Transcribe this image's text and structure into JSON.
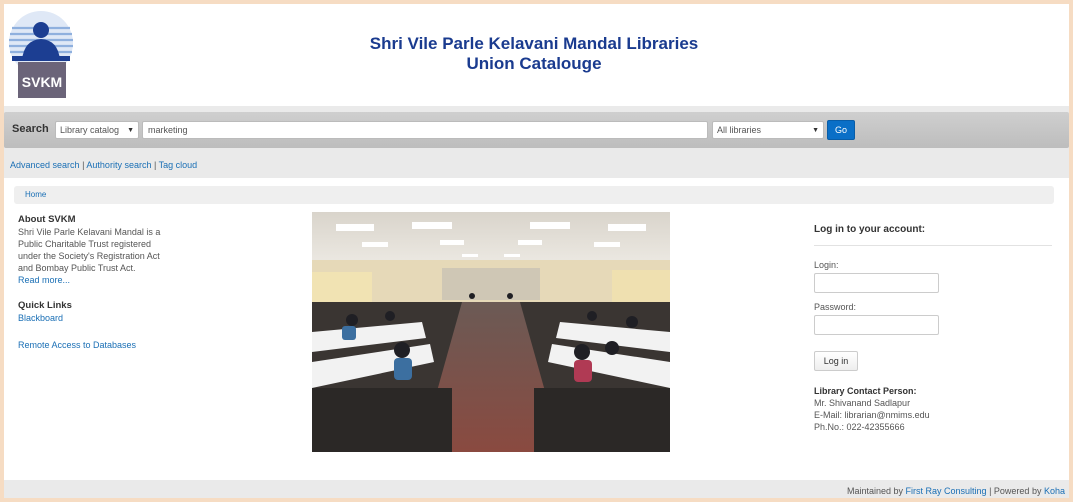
{
  "header": {
    "logo_text": "SVKM",
    "title_line1": "Shri Vile Parle Kelavani Mandal Libraries",
    "title_line2": "Union Catalouge"
  },
  "search": {
    "label": "Search",
    "catalog_select": "Library catalog",
    "query_value": "marketing",
    "libraries_select": "All libraries",
    "go_label": "Go"
  },
  "links": {
    "advanced": "Advanced search",
    "authority": "Authority search",
    "tagcloud": "Tag cloud",
    "separator": "|"
  },
  "breadcrumb": {
    "home": "Home"
  },
  "about": {
    "heading": "About SVKM",
    "text": "Shri Vile Parle Kelavani Mandal is a Public Charitable Trust registered under the Society's Registration Act and Bombay Public Trust Act.",
    "read_more": "Read more..."
  },
  "quick_links": {
    "heading": "Quick Links",
    "blackboard": "Blackboard",
    "remote": "Remote Access to Databases"
  },
  "login": {
    "heading": "Log in to your account:",
    "login_label": "Login:",
    "password_label": "Password:",
    "button": "Log in"
  },
  "contact": {
    "heading": "Library Contact Person:",
    "name": "Mr. Shivanand Sadlapur",
    "email": "E-Mail: librarian@nmims.edu",
    "phone": "Ph.No.: 022-42355666"
  },
  "footer": {
    "maintained": "Maintained by",
    "maintainer": "First Ray Consulting",
    "powered": "| Powered by",
    "koha": "Koha"
  },
  "colors": {
    "title": "#1a3b8f",
    "link": "#1a6fb5",
    "go_button": "#0a6fc7",
    "frame": "#f6dcc3"
  }
}
